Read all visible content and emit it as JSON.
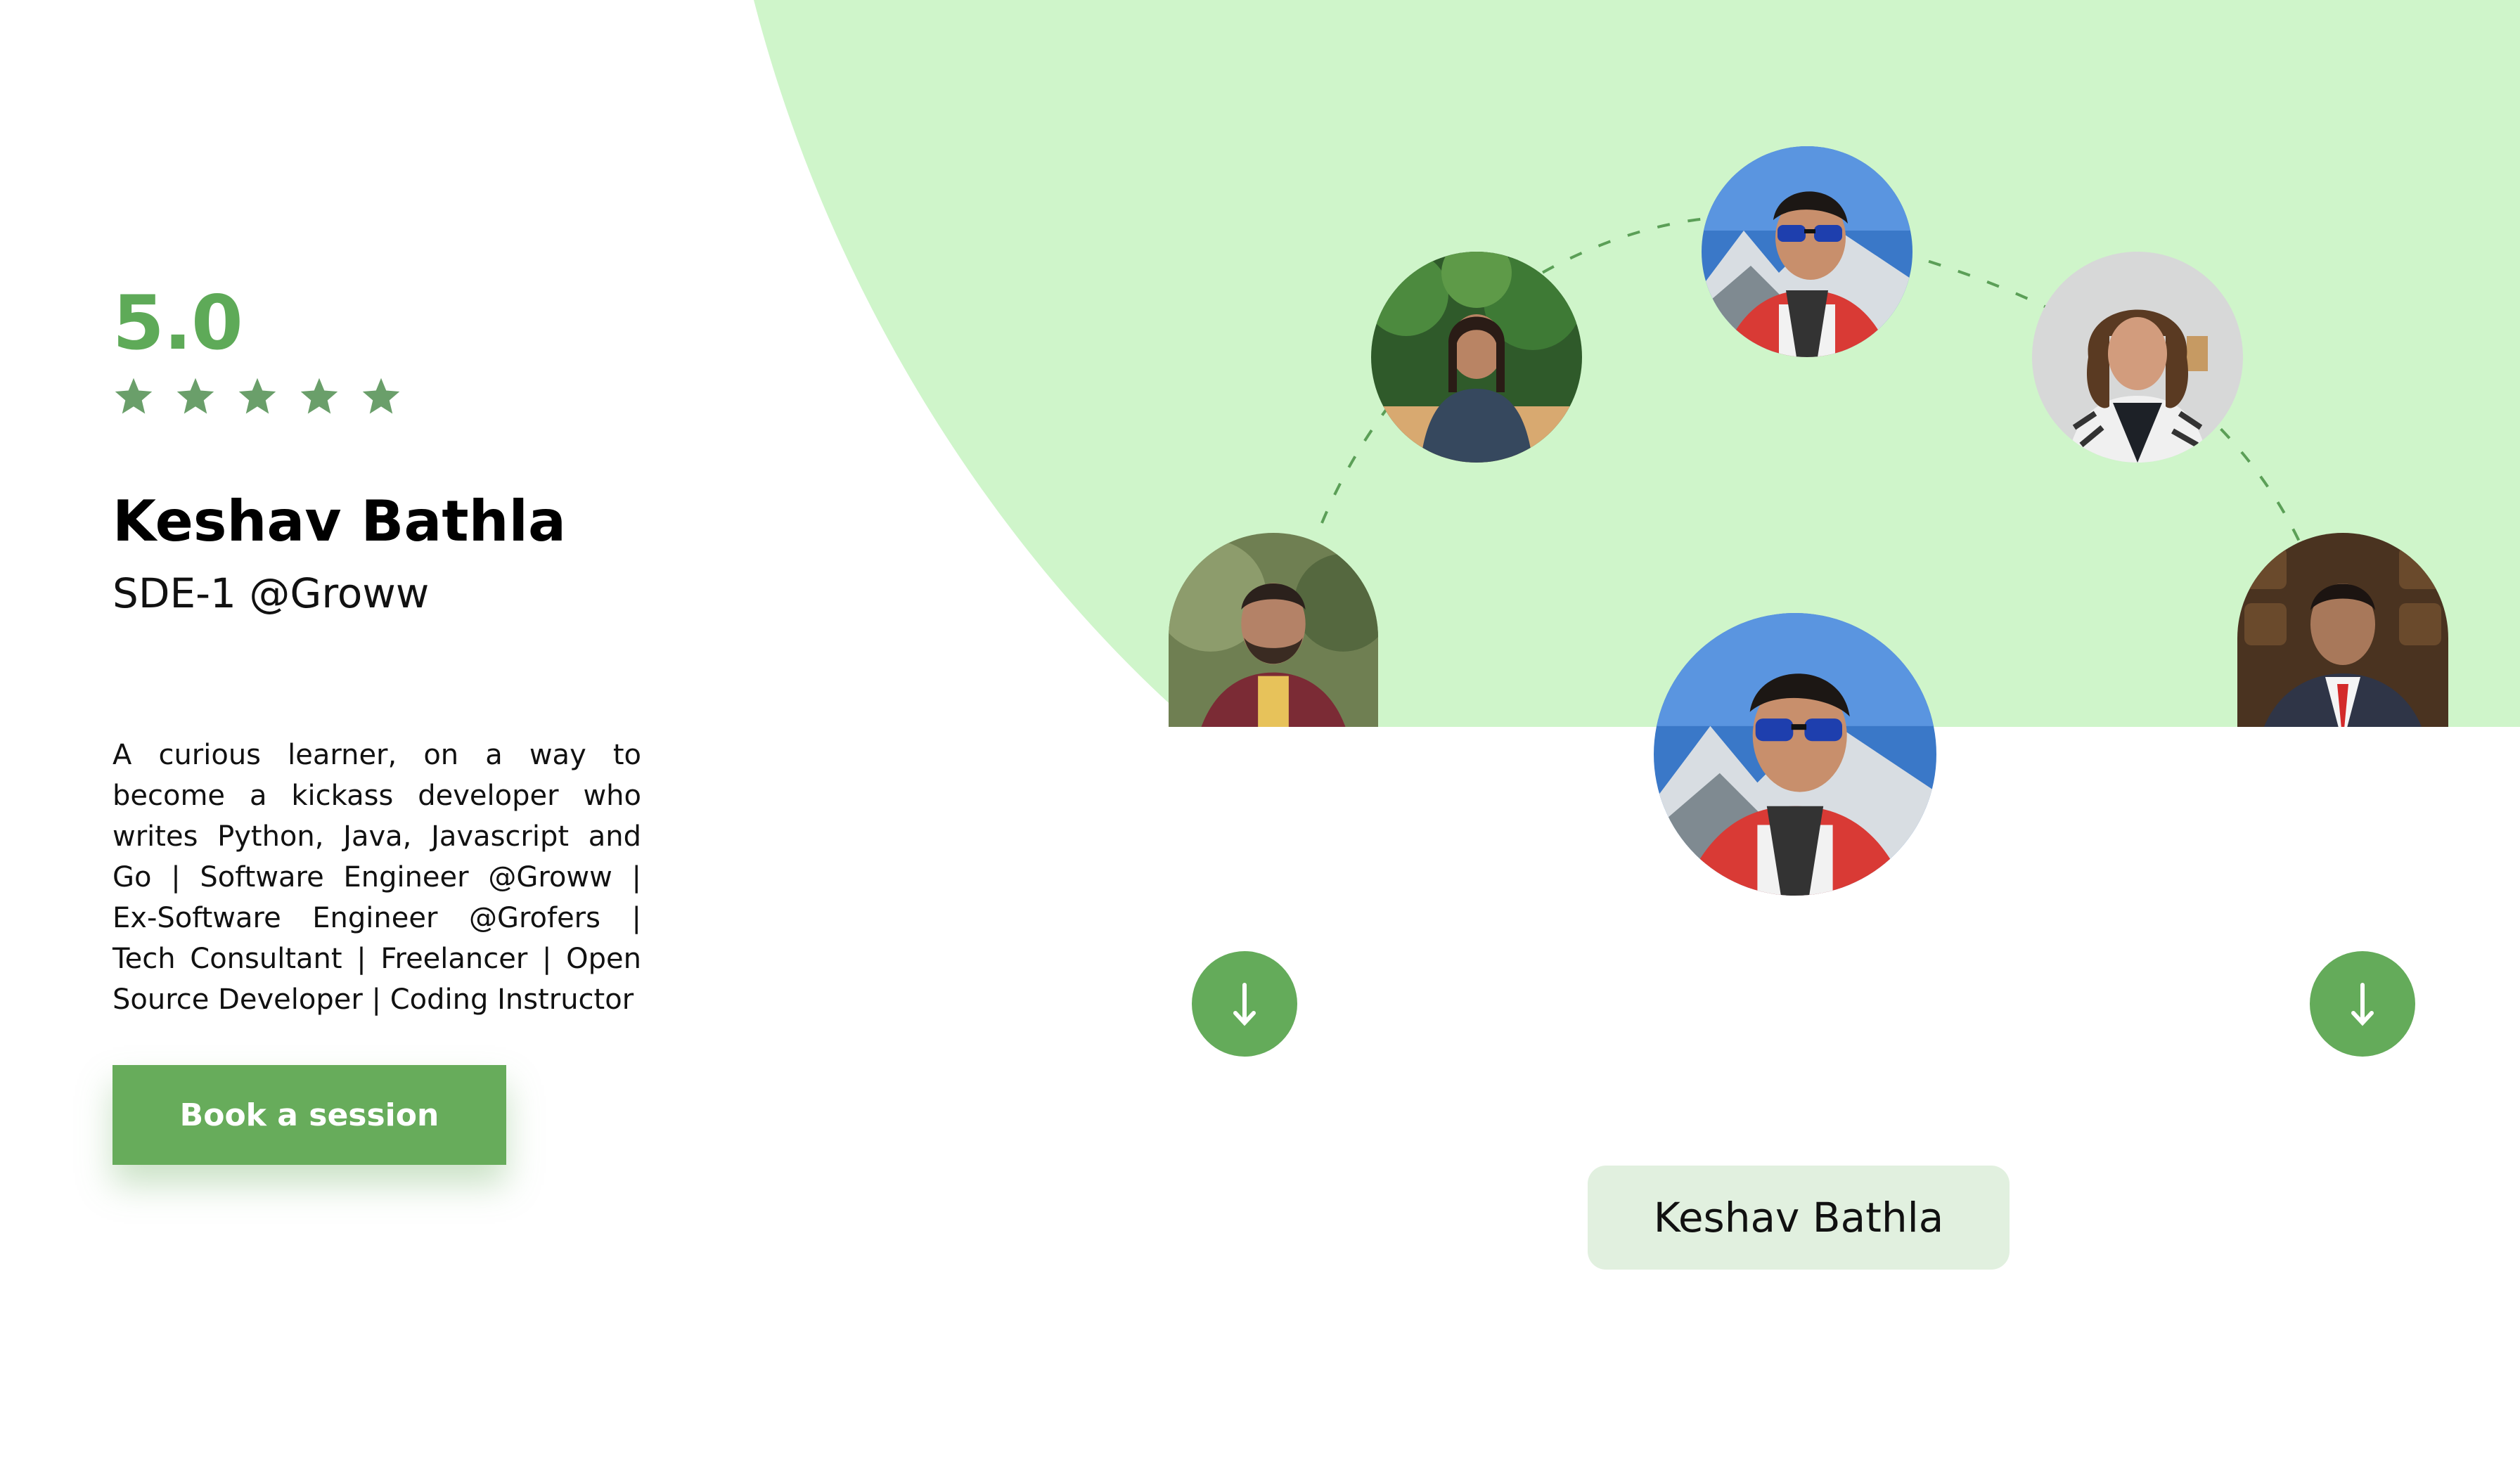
{
  "colors": {
    "accent": "#64ab5a",
    "blob": "#cff5ca",
    "star": "#6a9f6a",
    "chip_bg": "#e1f0df"
  },
  "profile": {
    "rating": "5.0",
    "stars": 5,
    "name": "Keshav Bathla",
    "role": "SDE-1 @Groww",
    "bio": "A curious learner, on a way to become a kickass developer who writes Python, Java, Javascript and Go | Software Engineer @Groww | Ex-Software Engineer @Grofers | Tech Consultant | Freelancer | Open Source Developer | Coding Instructor",
    "cta_label": "Book a session"
  },
  "carousel": {
    "selected_name": "Keshav Bathla",
    "prev_icon": "arrow-down-icon",
    "next_icon": "arrow-down-icon",
    "avatars": [
      {
        "icon": "mentor-photo-man-beard"
      },
      {
        "icon": "mentor-photo-woman-plants"
      },
      {
        "icon": "mentor-photo-man-sunglasses"
      },
      {
        "icon": "mentor-photo-woman-curly-hair"
      },
      {
        "icon": "mentor-photo-man-suit"
      }
    ],
    "featured_icon": "mentor-photo-man-sunglasses"
  }
}
